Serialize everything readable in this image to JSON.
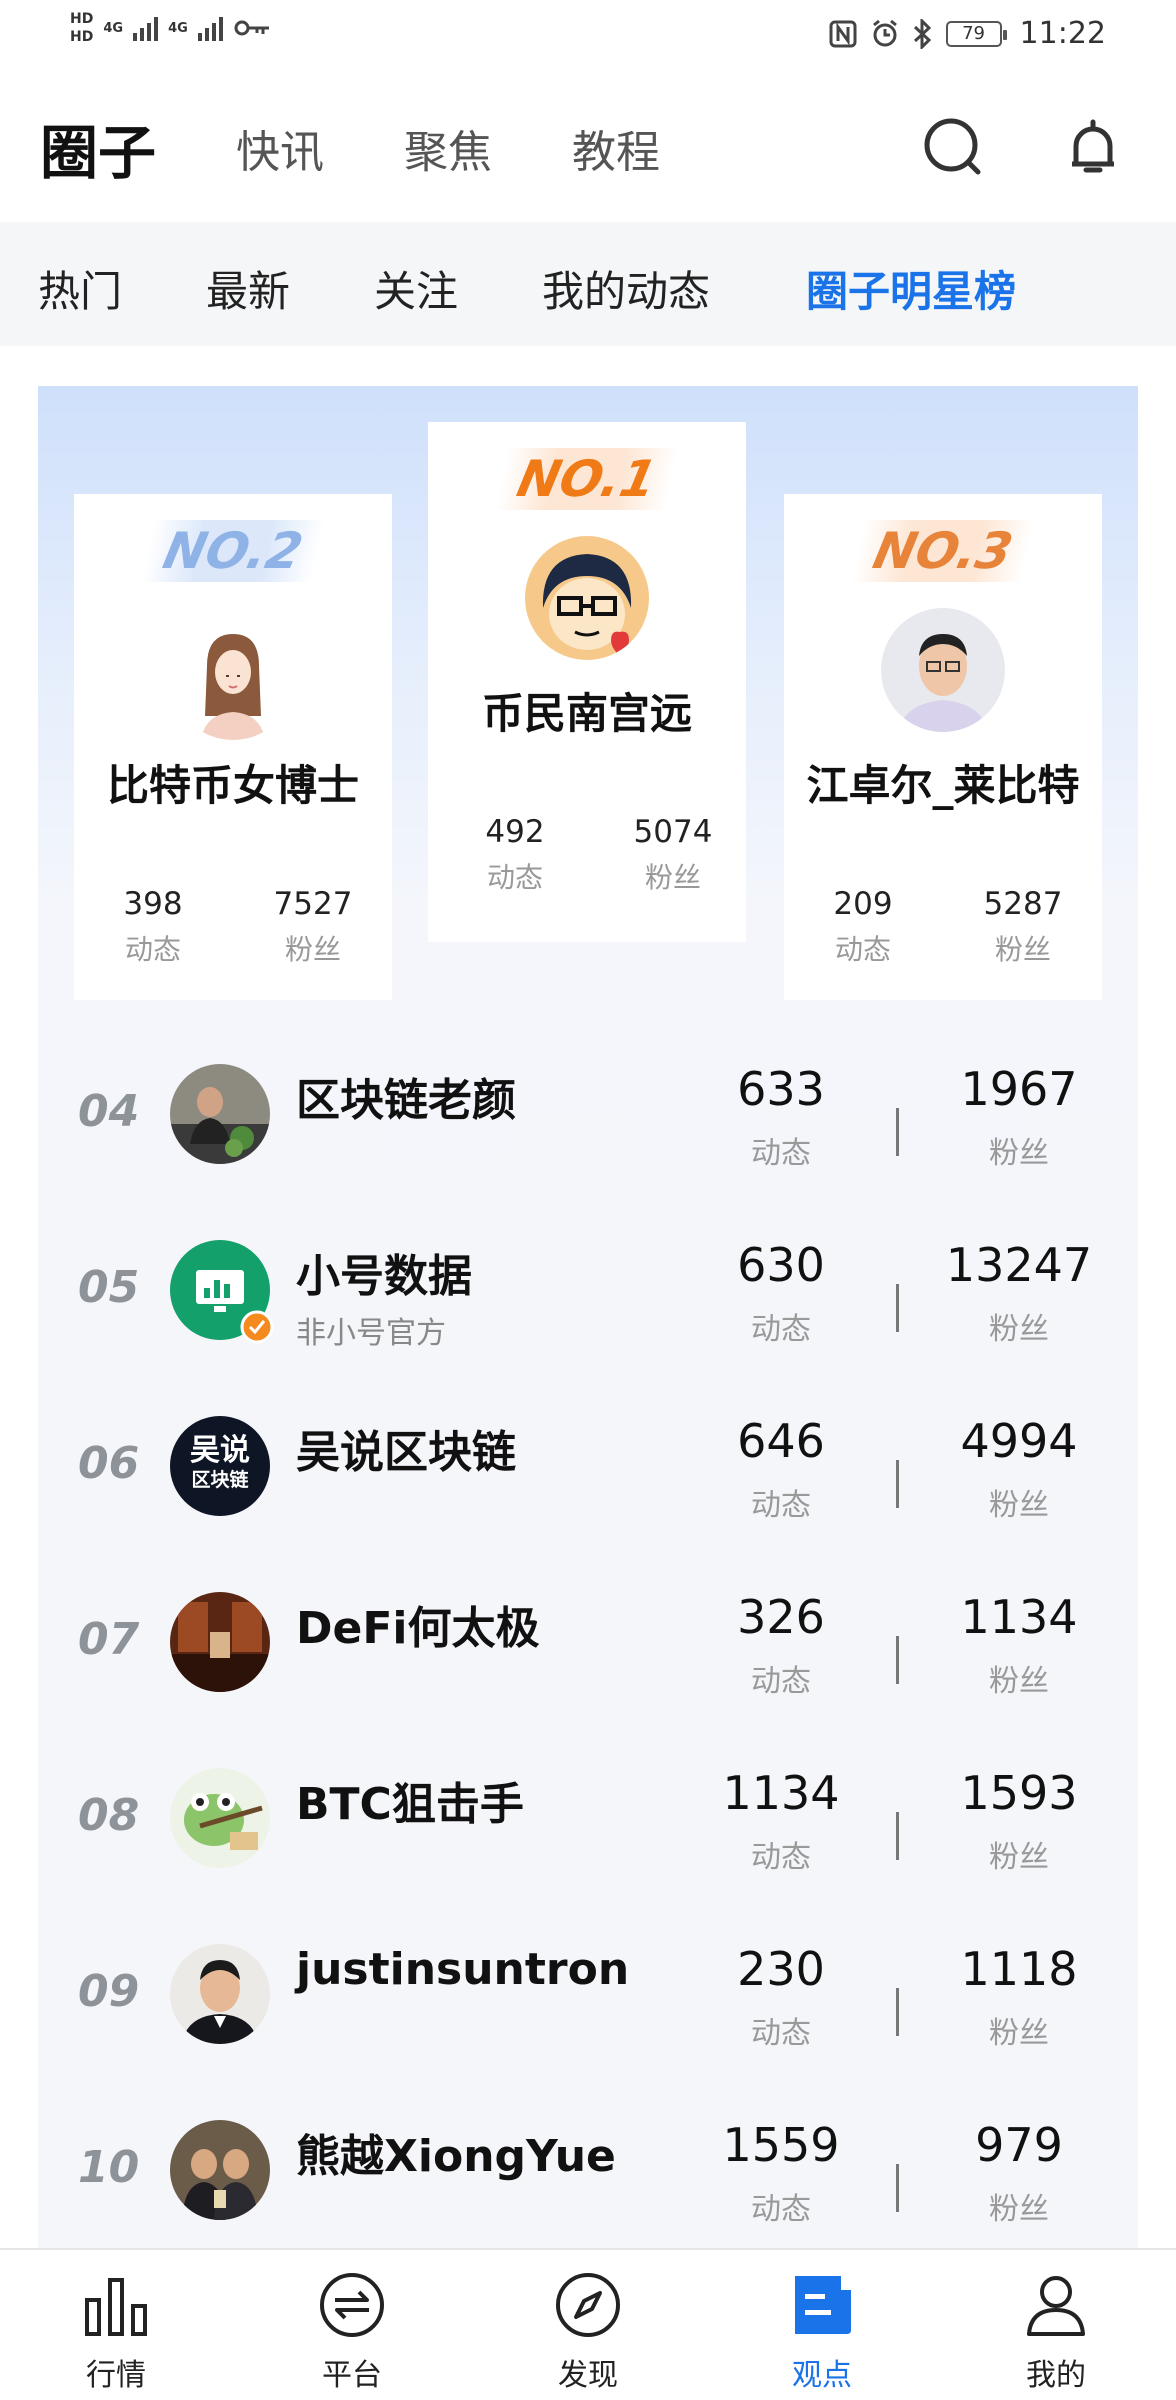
{
  "status_bar": {
    "time": "11:22",
    "battery": "79",
    "hd1": "HD",
    "hd2": "HD",
    "net1": "4G",
    "net2": "4G"
  },
  "top_nav": {
    "brand": "圈子",
    "tabs": [
      "快讯",
      "聚焦",
      "教程"
    ],
    "icons": [
      "search-icon",
      "bell-icon"
    ]
  },
  "sub_tabs": {
    "items": [
      "热门",
      "最新",
      "关注",
      "我的动态",
      "圈子明星榜"
    ],
    "active": "圈子明星榜",
    "accent_color": "#1a73e8"
  },
  "podium": {
    "first": {
      "badge": "NO.1",
      "name": "币民南宫远",
      "posts": "492",
      "fans": "5074",
      "posts_label": "动态",
      "fans_label": "粉丝"
    },
    "second": {
      "badge": "NO.2",
      "name": "比特币女博士",
      "posts": "398",
      "fans": "7527",
      "posts_label": "动态",
      "fans_label": "粉丝"
    },
    "third": {
      "badge": "NO.3",
      "name": "江卓尔_莱比特",
      "posts": "209",
      "fans": "5287",
      "posts_label": "动态",
      "fans_label": "粉丝"
    }
  },
  "ranking": {
    "posts_label": "动态",
    "fans_label": "粉丝",
    "rows": [
      {
        "rank": "04",
        "name": "区块链老颜",
        "sub": "",
        "posts": "633",
        "fans": "1967"
      },
      {
        "rank": "05",
        "name": "小号数据",
        "sub": "非小号官方",
        "posts": "630",
        "fans": "13247"
      },
      {
        "rank": "06",
        "name": "吴说区块链",
        "sub": "",
        "posts": "646",
        "fans": "4994",
        "avatar_text": [
          "吴说",
          "区块链"
        ]
      },
      {
        "rank": "07",
        "name": "DeFi何太极",
        "sub": "",
        "posts": "326",
        "fans": "1134"
      },
      {
        "rank": "08",
        "name": "BTC狙击手",
        "sub": "",
        "posts": "1134",
        "fans": "1593"
      },
      {
        "rank": "09",
        "name": "justinsuntron",
        "sub": "",
        "posts": "230",
        "fans": "1118"
      },
      {
        "rank": "10",
        "name": "熊越XiongYue",
        "sub": "",
        "posts": "1559",
        "fans": "979"
      }
    ]
  },
  "bottom_nav": {
    "items": [
      "行情",
      "平台",
      "发现",
      "观点",
      "我的"
    ],
    "active": "观点"
  }
}
